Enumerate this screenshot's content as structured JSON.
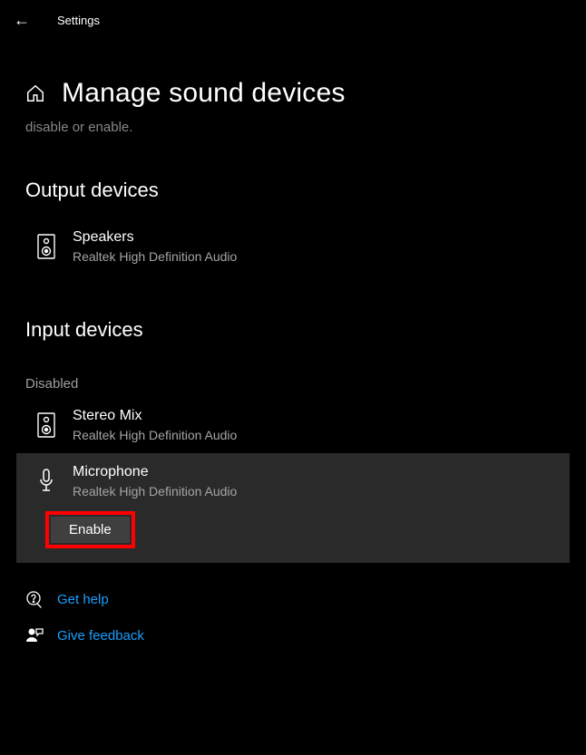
{
  "titlebar": {
    "label": "Settings"
  },
  "header": {
    "title": "Manage sound devices"
  },
  "truncated_line": "disable or enable.",
  "sections": {
    "output": {
      "heading": "Output devices",
      "devices": [
        {
          "name": "Speakers",
          "subtitle": "Realtek High Definition Audio"
        }
      ]
    },
    "input": {
      "heading": "Input devices",
      "disabled_label": "Disabled",
      "devices": [
        {
          "name": "Stereo Mix",
          "subtitle": "Realtek High Definition Audio"
        },
        {
          "name": "Microphone",
          "subtitle": "Realtek High Definition Audio"
        }
      ],
      "enable_button": "Enable"
    }
  },
  "links": {
    "help": "Get help",
    "feedback": "Give feedback"
  }
}
